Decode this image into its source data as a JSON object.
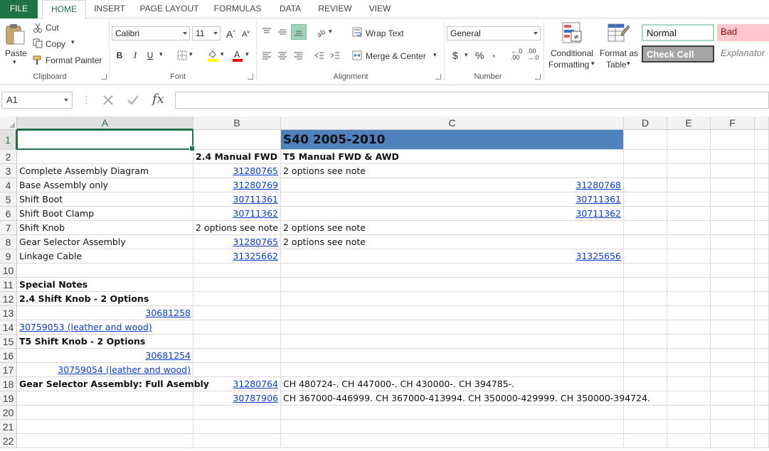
{
  "tabs": [
    "FILE",
    "HOME",
    "INSERT",
    "PAGE LAYOUT",
    "FORMULAS",
    "DATA",
    "REVIEW",
    "VIEW"
  ],
  "clipboard": {
    "paste": "Paste",
    "cut": "Cut",
    "copy": "Copy",
    "format_painter": "Format Painter",
    "label": "Clipboard"
  },
  "font": {
    "name": "Calibri",
    "size": "11",
    "bold": "B",
    "italic": "I",
    "underline": "U",
    "label": "Font"
  },
  "alignment": {
    "wrap_text": "Wrap Text",
    "merge_center": "Merge & Center",
    "label": "Alignment"
  },
  "number": {
    "format": "General",
    "currency": "$",
    "percent": "%",
    "comma": ",",
    "inc_decimal": "←.0 .00",
    "dec_decimal": ".00 →.0",
    "label": "Number"
  },
  "styles": {
    "conditional_1": "Conditional",
    "conditional_2": "Formatting",
    "format_as_1": "Format as",
    "format_as_2": "Table",
    "normal": "Normal",
    "bad": "Bad",
    "check_cell": "Check Cell",
    "explanatory": "Explanator"
  },
  "formula_bar": {
    "name_box": "A1",
    "fx": "fx",
    "value": ""
  },
  "columns": [
    "A",
    "B",
    "C",
    "D",
    "E",
    "F"
  ],
  "rows": [
    "1",
    "2",
    "3",
    "4",
    "5",
    "6",
    "7",
    "8",
    "9",
    "10",
    "11",
    "12",
    "13",
    "14",
    "15",
    "16",
    "17",
    "18",
    "19",
    "20",
    "21",
    "22"
  ],
  "cells": {
    "C1": "S40 2005-2010",
    "B2": "2.4 Manual FWD",
    "C2": "T5 Manual FWD & AWD",
    "A3": "Complete Assembly Diagram",
    "B3": "31280765",
    "C3": "2 options see note",
    "A4": "Base Assembly only",
    "B4": "31280769",
    "C4": "31280768",
    "A5": "Shift Boot",
    "B5": "30711361",
    "C5": "30711361",
    "A6": "Shift Boot Clamp",
    "B6": "30711362",
    "C6": "30711362",
    "A7": "Shift Knob",
    "B7": "2 options see note",
    "C7": "2 options see note",
    "A8": "Gear Selector Assembly",
    "B8": "31280765",
    "C8": "2 options see note",
    "A9": "Linkage Cable",
    "B9": "31325662",
    "C9": "31325656",
    "A11": "Special Notes",
    "A12": "2.4 Shift Knob - 2 Options",
    "A13": "30681258",
    "A14": "30759053 (leather and wood)",
    "A15": "T5 Shift Knob - 2 Options",
    "A16": "30681254",
    "A17": "30759054 (leather and wood)",
    "A18": "Gear Selector Assembly: Full Asembly",
    "B18": "31280764",
    "C18": "CH 480724-. CH 447000-. CH 430000-. CH 394785-.",
    "B19": "30787906",
    "C19": "CH 367000-446999. CH 367000-413994. CH 350000-429999. CH 350000-394724."
  },
  "colors": {
    "accent": "#217346",
    "header_fill": "#4f81bd",
    "link": "#0b3dcf",
    "normal_style_border": "#a9d8c0",
    "bad_fill": "#ffc7ce",
    "bad_text": "#9c0006",
    "check_fill": "#a5a5a5"
  }
}
